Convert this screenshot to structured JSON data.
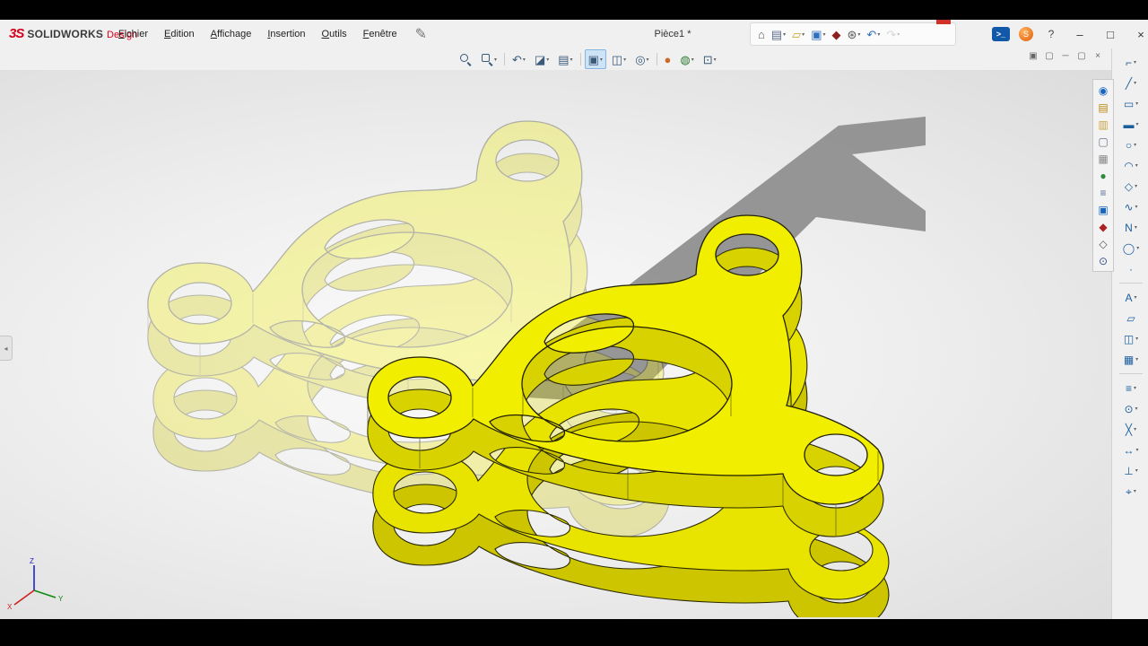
{
  "window": {
    "document_title": "Pièce1 *"
  },
  "titlebar": {
    "brand": {
      "mark": "3S",
      "name": "SOLIDWORKS",
      "edition": "Design"
    },
    "menu_items": [
      "Fichier",
      "Edition",
      "Affichage",
      "Insertion",
      "Outils",
      "Fenêtre"
    ],
    "quick_access": [
      {
        "name": "home",
        "glyph": "⌂",
        "color": "#5a5a5a",
        "caret": false
      },
      {
        "name": "new-document",
        "glyph": "▤",
        "color": "#5a6a8a",
        "caret": true
      },
      {
        "name": "open",
        "glyph": "▱",
        "color": "#c9a227",
        "caret": true
      },
      {
        "name": "save",
        "glyph": "▣",
        "color": "#2f6fbf",
        "caret": true
      },
      {
        "name": "rebuild",
        "glyph": "◆",
        "color": "#8d1f1f",
        "caret": false
      },
      {
        "name": "options",
        "glyph": "⊛",
        "color": "#5a5a5a",
        "caret": true
      },
      {
        "name": "undo",
        "glyph": "↶",
        "color": "#2f6fbf",
        "caret": true
      },
      {
        "name": "redo",
        "glyph": "↷",
        "color": "#9aa0a6",
        "caret": true,
        "disabled": true
      }
    ],
    "right_controls": [
      {
        "name": "solidworks-search",
        "glyph": ">_",
        "kind": "blue-box"
      },
      {
        "name": "assistant",
        "glyph": "S",
        "kind": "orange-ball"
      },
      {
        "name": "help",
        "glyph": "?",
        "kind": "plain"
      },
      {
        "name": "minimize",
        "glyph": "–",
        "kind": "winbtn"
      },
      {
        "name": "maximize",
        "glyph": "□",
        "kind": "winbtn"
      },
      {
        "name": "close",
        "glyph": "×",
        "kind": "winbtn"
      }
    ]
  },
  "heads_up_toolbar": [
    {
      "name": "zoom-to-fit",
      "type": "mag"
    },
    {
      "name": "zoom-to-area",
      "type": "mag-area",
      "caret": true
    },
    {
      "name": "previous-view",
      "glyph": "↶",
      "caret": true
    },
    {
      "name": "section-view",
      "glyph": "◪",
      "caret": true
    },
    {
      "name": "annotation-views",
      "glyph": "▤",
      "caret": true
    },
    {
      "name": "view-orientation",
      "glyph": "▣",
      "caret": true,
      "active": true
    },
    {
      "name": "display-style",
      "glyph": "◫",
      "caret": true
    },
    {
      "name": "hide-show-items",
      "glyph": "◎",
      "caret": true
    },
    {
      "name": "edit-appearance",
      "glyph": "●",
      "color": "#c96a2a"
    },
    {
      "name": "realview",
      "glyph": "◍",
      "color": "#2e7d32",
      "caret": true
    },
    {
      "name": "view-settings",
      "glyph": "⊡",
      "caret": true
    }
  ],
  "viewport_controls": [
    {
      "name": "tile-window",
      "glyph": "▣"
    },
    {
      "name": "cascade-window",
      "glyph": "▢"
    },
    {
      "name": "minimize-document",
      "glyph": "─"
    },
    {
      "name": "restore-document",
      "glyph": "▢"
    },
    {
      "name": "close-document",
      "glyph": "×"
    }
  ],
  "task_pane": [
    {
      "name": "solidworks-resources",
      "glyph": "◉",
      "color": "#1565c0"
    },
    {
      "name": "design-library",
      "glyph": "▤",
      "color": "#b8860b"
    },
    {
      "name": "file-explorer",
      "glyph": "▥",
      "color": "#caa53d"
    },
    {
      "name": "open-documents",
      "glyph": "▢",
      "color": "#667788"
    },
    {
      "name": "view-palette",
      "glyph": "▦",
      "color": "#888888"
    },
    {
      "name": "appearances-scenes",
      "glyph": "●",
      "color": "#2e8b3a"
    },
    {
      "name": "custom-properties",
      "glyph": "≡",
      "color": "#556b9a"
    },
    {
      "name": "solidworks-forum",
      "glyph": "▣",
      "color": "#1565c0"
    },
    {
      "name": "document-recovery",
      "glyph": "◆",
      "color": "#aa2222"
    },
    {
      "name": "pack-and-go",
      "glyph": "◇",
      "color": "#555555"
    },
    {
      "name": "search-commands",
      "glyph": "⊙",
      "color": "#335588"
    }
  ],
  "sketch_toolbar": {
    "groups": [
      {
        "items": [
          {
            "name": "select",
            "glyph": "⌐",
            "caret": true
          },
          {
            "name": "line",
            "glyph": "╱",
            "caret": true
          },
          {
            "name": "corner-rectangle",
            "glyph": "▭",
            "caret": true
          },
          {
            "name": "straight-slot",
            "glyph": "▬",
            "caret": true
          },
          {
            "name": "circle",
            "glyph": "○",
            "caret": true
          },
          {
            "name": "arc",
            "glyph": "◠",
            "caret": true
          },
          {
            "name": "polygon",
            "glyph": "◇",
            "caret": true
          },
          {
            "name": "spline",
            "glyph": "∿",
            "caret": true
          },
          {
            "name": "styled-spline",
            "glyph": "N",
            "caret": true
          },
          {
            "name": "ellipse",
            "glyph": "◯",
            "caret": true
          },
          {
            "name": "point",
            "glyph": "·",
            "caret": false
          }
        ]
      },
      {
        "items": [
          {
            "name": "text",
            "glyph": "A",
            "caret": true
          },
          {
            "name": "plane",
            "glyph": "▱",
            "caret": false
          },
          {
            "name": "mirror-entities",
            "glyph": "◫",
            "caret": true
          },
          {
            "name": "linear-pattern",
            "glyph": "▦",
            "caret": true
          }
        ]
      },
      {
        "items": [
          {
            "name": "offset-entities",
            "glyph": "≡",
            "caret": true
          },
          {
            "name": "convert-entities",
            "glyph": "⊙",
            "caret": true
          },
          {
            "name": "trim-entities",
            "glyph": "╳",
            "caret": true
          },
          {
            "name": "smart-dimension",
            "glyph": "↔",
            "caret": true
          },
          {
            "name": "display-relations",
            "glyph": "⊥",
            "caret": true
          },
          {
            "name": "quick-snaps",
            "glyph": "⌖",
            "caret": true
          }
        ]
      }
    ]
  },
  "triad": {
    "x": "X",
    "y": "Y",
    "z": "Z"
  },
  "colors": {
    "part_top": "#f2ee00",
    "part_side": "#d8d200",
    "part_bottom_top": "#e9e300",
    "part_bottom_side": "#ccc500",
    "shadow": "#8d8d8d",
    "active_highlight": "#cfe3f6",
    "brand_red": "#d6001c"
  }
}
